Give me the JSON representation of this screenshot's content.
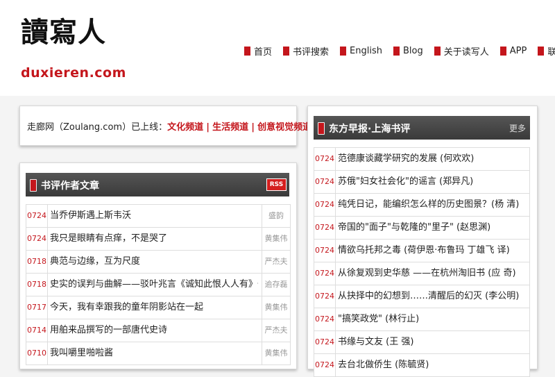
{
  "logo": {
    "chinese": "讀寫人",
    "domain": "duxieren.com"
  },
  "nav": [
    {
      "label": "首页"
    },
    {
      "label": "书评搜索"
    },
    {
      "label": "English"
    },
    {
      "label": "Blog"
    },
    {
      "label": "关于读写人"
    },
    {
      "label": "APP"
    },
    {
      "label": "联系"
    }
  ],
  "announcement": {
    "prefix": "走廊网（Zoulang.com）已上线：",
    "links": [
      "文化频道",
      "生活频道",
      "创意视觉频道"
    ],
    "separator": "|"
  },
  "left_section": {
    "title": "书评作者文章",
    "rss_label": "RSS",
    "items": [
      {
        "date": "0724",
        "title": "当乔伊斯遇上斯韦沃",
        "author": "盛韵"
      },
      {
        "date": "0724",
        "title": "我只是眼睛有点痒，不是哭了",
        "author": "黄集伟"
      },
      {
        "date": "0718",
        "title": "典范与边缘，互为尺度",
        "author": "严杰夫"
      },
      {
        "date": "0718",
        "title": "史实的误判与曲解——驳叶兆言《诚知此恨人人有》一文",
        "author": "逾存磊"
      },
      {
        "date": "0717",
        "title": "今天，我有幸跟我的童年阴影站在一起",
        "author": "黄集伟"
      },
      {
        "date": "0714",
        "title": "用舶来品撰写的一部唐代史诗",
        "author": "严杰夫"
      },
      {
        "date": "0710",
        "title": "我叫嚼里啪啦酱",
        "author": "黄集伟"
      }
    ]
  },
  "right_section": {
    "title": "东方早报·上海书评",
    "more_label": "更多",
    "items": [
      {
        "date": "0724",
        "title": "范德康谈藏学研究的发展 (何欢欢)"
      },
      {
        "date": "0724",
        "title": "苏俄\"妇女社会化\"的谣言 (郑异凡)"
      },
      {
        "date": "0724",
        "title": "纯凭日记，能编织怎么样的历史图景？(杨 清)"
      },
      {
        "date": "0724",
        "title": "帝国的\"面子\"与乾隆的\"里子\" (赵思渊)"
      },
      {
        "date": "0724",
        "title": "情欲乌托邦之毒 (荷伊恩·布鲁玛 丁雄飞 译)"
      },
      {
        "date": "0724",
        "title": "从徐复观到史华慈 ——在杭州淘旧书 (应 奇)"
      },
      {
        "date": "0724",
        "title": "从抉择中的幻想到……清醒后的幻灭 (李公明)"
      },
      {
        "date": "0724",
        "title": "\"搞笑政党\" (林行止)"
      },
      {
        "date": "0724",
        "title": "书缘与文友 (王 强)"
      },
      {
        "date": "0724",
        "title": "去台北做侨生 (陈毓贤)"
      }
    ]
  },
  "colors": {
    "accent": "#c4161c",
    "bar": "#444444"
  }
}
